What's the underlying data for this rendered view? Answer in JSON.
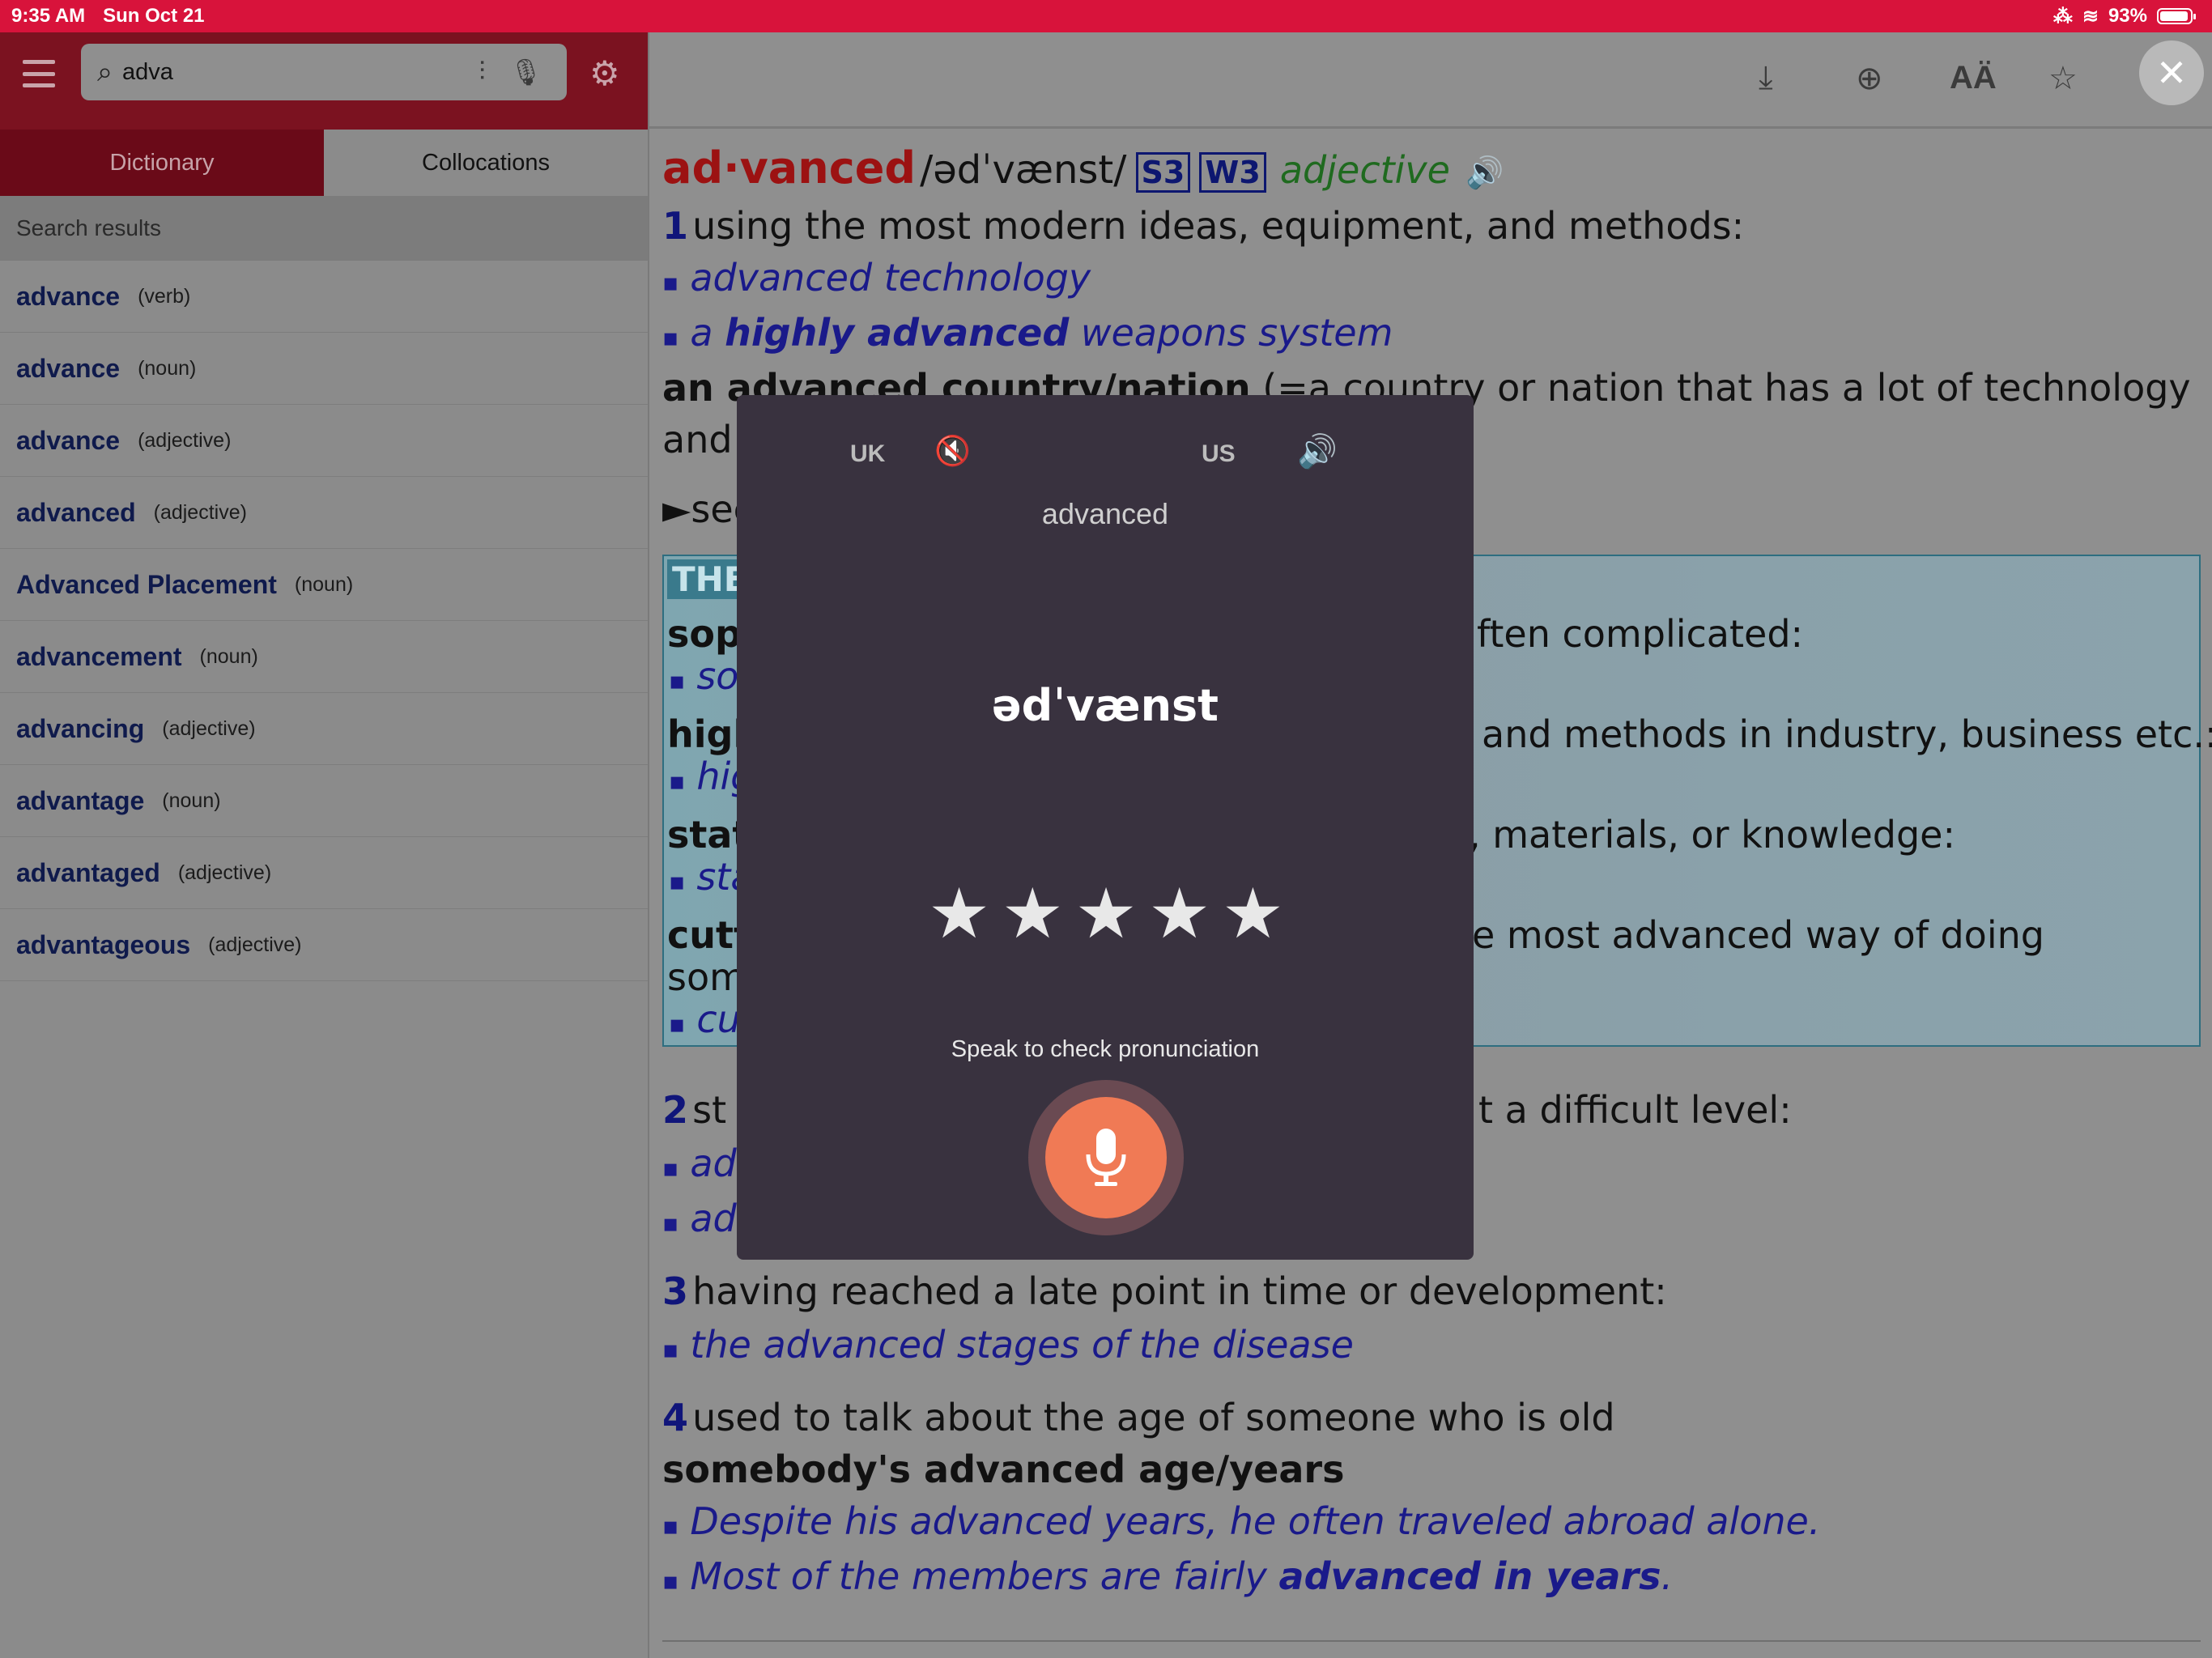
{
  "status": {
    "time": "9:35 AM",
    "date": "Sun Oct 21",
    "battery": "93%",
    "battery_level": 0.93
  },
  "search": {
    "query": "adva"
  },
  "tabs": {
    "dictionary": "Dictionary",
    "collocations": "Collocations"
  },
  "sidebar": {
    "label": "Search results",
    "results": [
      {
        "word": "advance",
        "pos": "(verb)"
      },
      {
        "word": "advance",
        "pos": "(noun)"
      },
      {
        "word": "advance",
        "pos": "(adjective)"
      },
      {
        "word": "advanced",
        "pos": "(adjective)"
      },
      {
        "word": "Advanced Placement",
        "pos": "(noun)"
      },
      {
        "word": "advancement",
        "pos": "(noun)"
      },
      {
        "word": "advancing",
        "pos": "(adjective)"
      },
      {
        "word": "advantage",
        "pos": "(noun)"
      },
      {
        "word": "advantaged",
        "pos": "(adjective)"
      },
      {
        "word": "advantageous",
        "pos": "(adjective)"
      }
    ]
  },
  "entry": {
    "headword": "ad·vanced",
    "ipa": "/ədˈvænst/",
    "badge1": "S3",
    "badge2": "W3",
    "pos": "adjective",
    "s1_num": "1",
    "s1_def": "using the most modern ideas, equipment, and methods:",
    "s1_ex1": "advanced technology",
    "s1_ex2_a": "a ",
    "s1_ex2_b": "highly advanced",
    "s1_ex2_c": " weapons system",
    "s1_phrase": "an advanced country/nation",
    "s1_phrase_def": " (=a country or nation that has a lot of technology",
    "s1_and": "and",
    "see": "►see",
    "thes_head": "THE",
    "thes_1_word": "sop",
    "thes_1_rest": "ften complicated:",
    "thes_1_ex": "so",
    "thes_2_word": "higl",
    "thes_2_rest": "and methods in industry, business etc.:",
    "thes_2_ex": "hig",
    "thes_3_word": "stat",
    "thes_3_rest": ", materials, or knowledge:",
    "thes_3_ex": "sta",
    "thes_4_word": "cutt",
    "thes_4_rest": "e most advanced way of doing",
    "thes_4_more": "som",
    "thes_4_ex": "cu",
    "s2_num": "2",
    "s2_def": "st",
    "s2_rest": "t a difficult level:",
    "s2_ex1": "ad",
    "s2_ex2": "ad",
    "s3_num": "3",
    "s3_def": "having reached a late point in time or development:",
    "s3_ex": "the advanced stages of the disease",
    "s4_num": "4",
    "s4_def": "used to talk about the age of someone who is old",
    "s4_phrase": "somebody's advanced age/years",
    "s4_ex1": "Despite his advanced years, he often traveled abroad alone.",
    "s4_ex2_a": "Most of the members are fairly ",
    "s4_ex2_b": "advanced in years",
    "s4_ex2_c": "."
  },
  "modal": {
    "uk_label": "UK",
    "us_label": "US",
    "word": "advanced",
    "ipa": "ədˈvænst",
    "stars": 5,
    "hint": "Speak to check pronunciation"
  },
  "colors": {
    "status_bar": "#d8133b",
    "accent_red": "#9c1212",
    "link_blue": "#1a1a8a",
    "mic": "#f07a55",
    "modal_bg": "#39323f"
  }
}
